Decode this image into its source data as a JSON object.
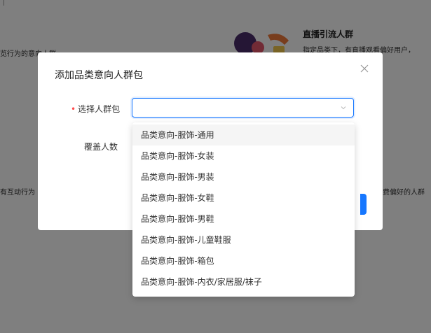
{
  "background": {
    "card_left_top_text": "览行为的意向人群",
    "card_right_top_title": "直播引流人群",
    "card_right_top_desc": "指定品类下，有直播观看偏好用户，",
    "card_left_mid_text": "有互动行为",
    "card_right_mid_text": "费偏好的人群"
  },
  "modal": {
    "title": "添加品类意向人群包",
    "close_icon": "close-icon",
    "select_label": "选择人群包",
    "required_mark": "•",
    "select_value": "",
    "coverage_label": "覆盖人数"
  },
  "dropdown": {
    "options": [
      "品类意向-服饰-通用",
      "品类意向-服饰-女装",
      "品类意向-服饰-男装",
      "品类意向-服饰-女鞋",
      "品类意向-服饰-男鞋",
      "品类意向-服饰-儿童鞋服",
      "品类意向-服饰-箱包",
      "品类意向-服饰-内衣/家居服/袜子"
    ],
    "active_index": 0
  },
  "colors": {
    "accent": "#1677ff",
    "required": "#ff4d4f",
    "overlay": "rgba(0,0,0,0.5)"
  }
}
